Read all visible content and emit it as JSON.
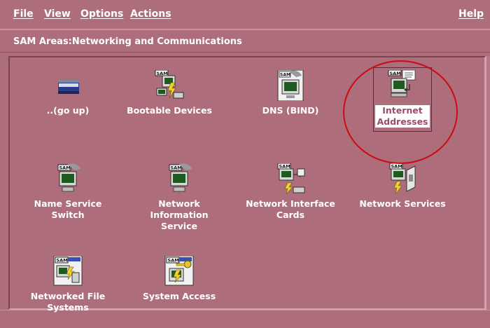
{
  "menubar": {
    "file": "File",
    "view": "View",
    "options": "Options",
    "actions": "Actions",
    "help": "Help"
  },
  "area_title": "SAM Areas:Networking and Communications",
  "items": [
    {
      "label": "..(go up)",
      "icon": "folder-up-icon"
    },
    {
      "label": "Bootable Devices",
      "icon": "bootable-devices-icon"
    },
    {
      "label": "DNS (BIND)",
      "icon": "dns-bind-icon"
    },
    {
      "label": "Internet\nAddresses",
      "icon": "internet-addresses-icon"
    },
    {
      "label": "Name Service\nSwitch",
      "icon": "name-service-switch-icon"
    },
    {
      "label": "Network\nInformation\nService",
      "icon": "network-information-service-icon"
    },
    {
      "label": "Network Interface\nCards",
      "icon": "network-interface-cards-icon"
    },
    {
      "label": "Network Services",
      "icon": "network-services-icon"
    },
    {
      "label": "Networked File\nSystems",
      "icon": "networked-file-systems-icon"
    },
    {
      "label": "System Access",
      "icon": "system-access-icon"
    }
  ],
  "icon_badge_text": "SAM",
  "colors": {
    "background": "#ad6d7b",
    "text": "#ffffff",
    "selection_text": "#a04a66",
    "annotation_circle": "#cc0a12"
  }
}
